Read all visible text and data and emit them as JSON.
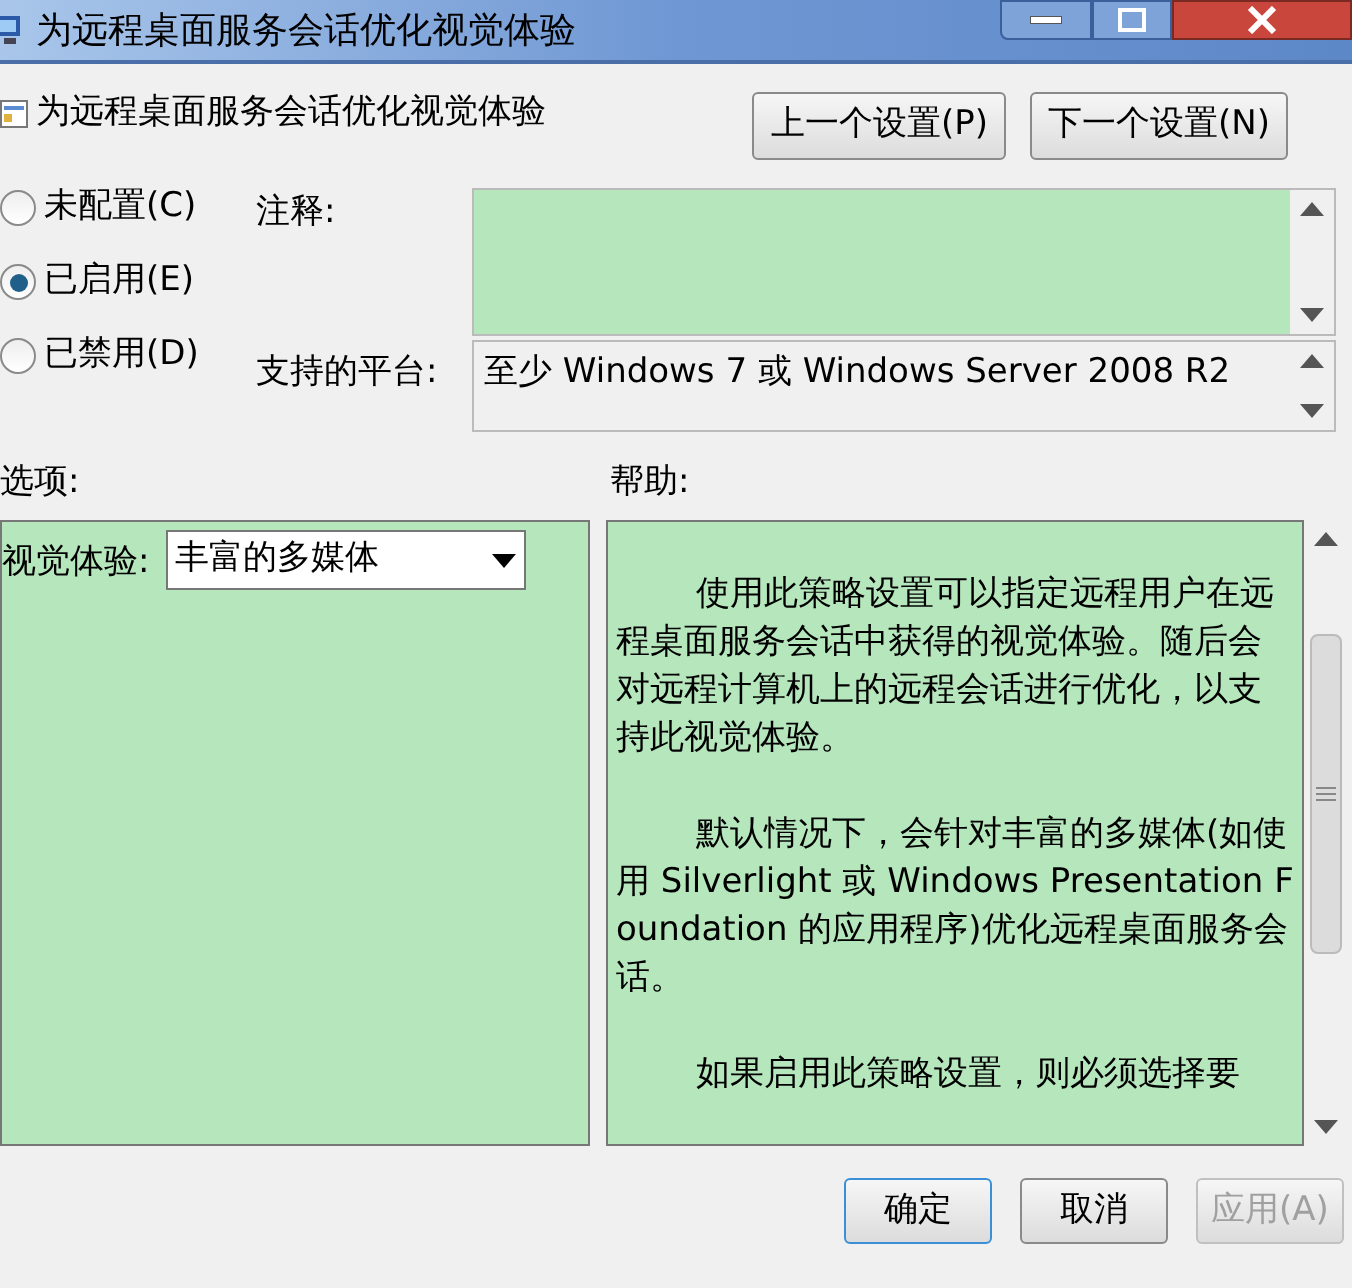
{
  "window": {
    "title": "为远程桌面服务会话优化视觉体验"
  },
  "header": {
    "title": "为远程桌面服务会话优化视觉体验",
    "buttons": [
      {
        "label": "上一个设置(P)"
      },
      {
        "label": "下一个设置(N)"
      }
    ]
  },
  "states": [
    {
      "label": "未配置(C)",
      "selected": false
    },
    {
      "label": "已启用(E)",
      "selected": true
    },
    {
      "label": "已禁用(D)",
      "selected": false
    }
  ],
  "comment": {
    "label": "注释:"
  },
  "platform": {
    "label": "支持的平台:",
    "value": "至少 Windows 7 或 Windows Server 2008 R2"
  },
  "options": {
    "label": "选项:",
    "setting": {
      "label": "视觉体验:",
      "value": "丰富的多媒体"
    }
  },
  "help": {
    "label": "帮助:",
    "paragraphs": [
      "使用此策略设置可以指定远程用户在远程桌面服务会话中获得的视觉体验。随后会对远程计算机上的远程会话进行优化，以支持此视觉体验。",
      "默认情况下，会针对丰富的多媒体(如使用 Silverlight 或 Windows Presentation Foundation 的应用程序)优化远程桌面服务会话。",
      "如果启用此策略设置，则必须选择要"
    ]
  },
  "footer": {
    "buttons": [
      {
        "label": "确定",
        "disabled": false,
        "default": true
      },
      {
        "label": "取消",
        "disabled": false,
        "default": false
      },
      {
        "label": "应用(A)",
        "disabled": true,
        "default": false
      }
    ]
  }
}
